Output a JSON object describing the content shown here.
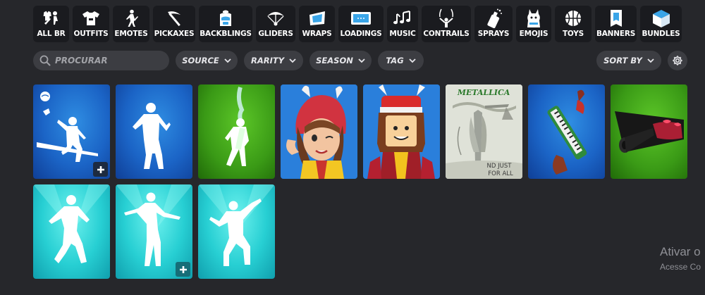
{
  "categories": [
    {
      "label": "ALL BR",
      "icon": "all-br-icon"
    },
    {
      "label": "OUTFITS",
      "icon": "shirt-icon"
    },
    {
      "label": "EMOTES",
      "icon": "dancing-figure-icon"
    },
    {
      "label": "PICKAXES",
      "icon": "pickaxe-icon"
    },
    {
      "label": "BACKBLINGS",
      "icon": "backpack-icon"
    },
    {
      "label": "GLIDERS",
      "icon": "glider-icon"
    },
    {
      "label": "WRAPS",
      "icon": "wrap-icon"
    },
    {
      "label": "LOADINGS",
      "icon": "loading-screen-icon"
    },
    {
      "label": "MUSIC",
      "icon": "music-note-icon"
    },
    {
      "label": "CONTRAILS",
      "icon": "contrail-icon"
    },
    {
      "label": "SPRAYS",
      "icon": "spray-can-icon"
    },
    {
      "label": "EMOJIS",
      "icon": "llama-icon"
    },
    {
      "label": "TOYS",
      "icon": "ball-icon"
    },
    {
      "label": "BANNERS",
      "icon": "banner-icon"
    },
    {
      "label": "BUNDLES",
      "icon": "box-icon"
    }
  ],
  "search": {
    "placeholder": "PROCURAR",
    "value": ""
  },
  "filters": {
    "source": "SOURCE",
    "rarity": "RARITY",
    "season": "SEASON",
    "tag": "TAG",
    "sort": "SORT BY"
  },
  "items": [
    {
      "type": "emote",
      "rarity_color": "#1b64c6",
      "has_plus": true
    },
    {
      "type": "emote",
      "rarity_color": "#1b64c6",
      "has_plus": false
    },
    {
      "type": "emote",
      "rarity_color": "#3a9a16",
      "has_plus": false
    },
    {
      "type": "outfit",
      "rarity_color": "#1b64c6",
      "has_plus": false
    },
    {
      "type": "outfit",
      "rarity_color": "#1b64c6",
      "has_plus": false
    },
    {
      "type": "loading",
      "rarity_color": "#d4d8cd",
      "has_plus": false,
      "art_text": {
        "logo": "METALLICA",
        "caption_1": "ND JUST",
        "caption_2": "FOR ALL"
      }
    },
    {
      "type": "pickaxe",
      "rarity_color": "#1b64c6",
      "has_plus": false
    },
    {
      "type": "wrap",
      "rarity_color": "#3a9a16",
      "has_plus": false
    },
    {
      "type": "emote",
      "rarity_color": "#27cfd3",
      "has_plus": false
    },
    {
      "type": "emote",
      "rarity_color": "#27cfd3",
      "has_plus": true
    },
    {
      "type": "emote",
      "rarity_color": "#27cfd3",
      "has_plus": false
    }
  ],
  "watermark": {
    "title": "Ativar o",
    "subtitle": "Acesse Co"
  }
}
